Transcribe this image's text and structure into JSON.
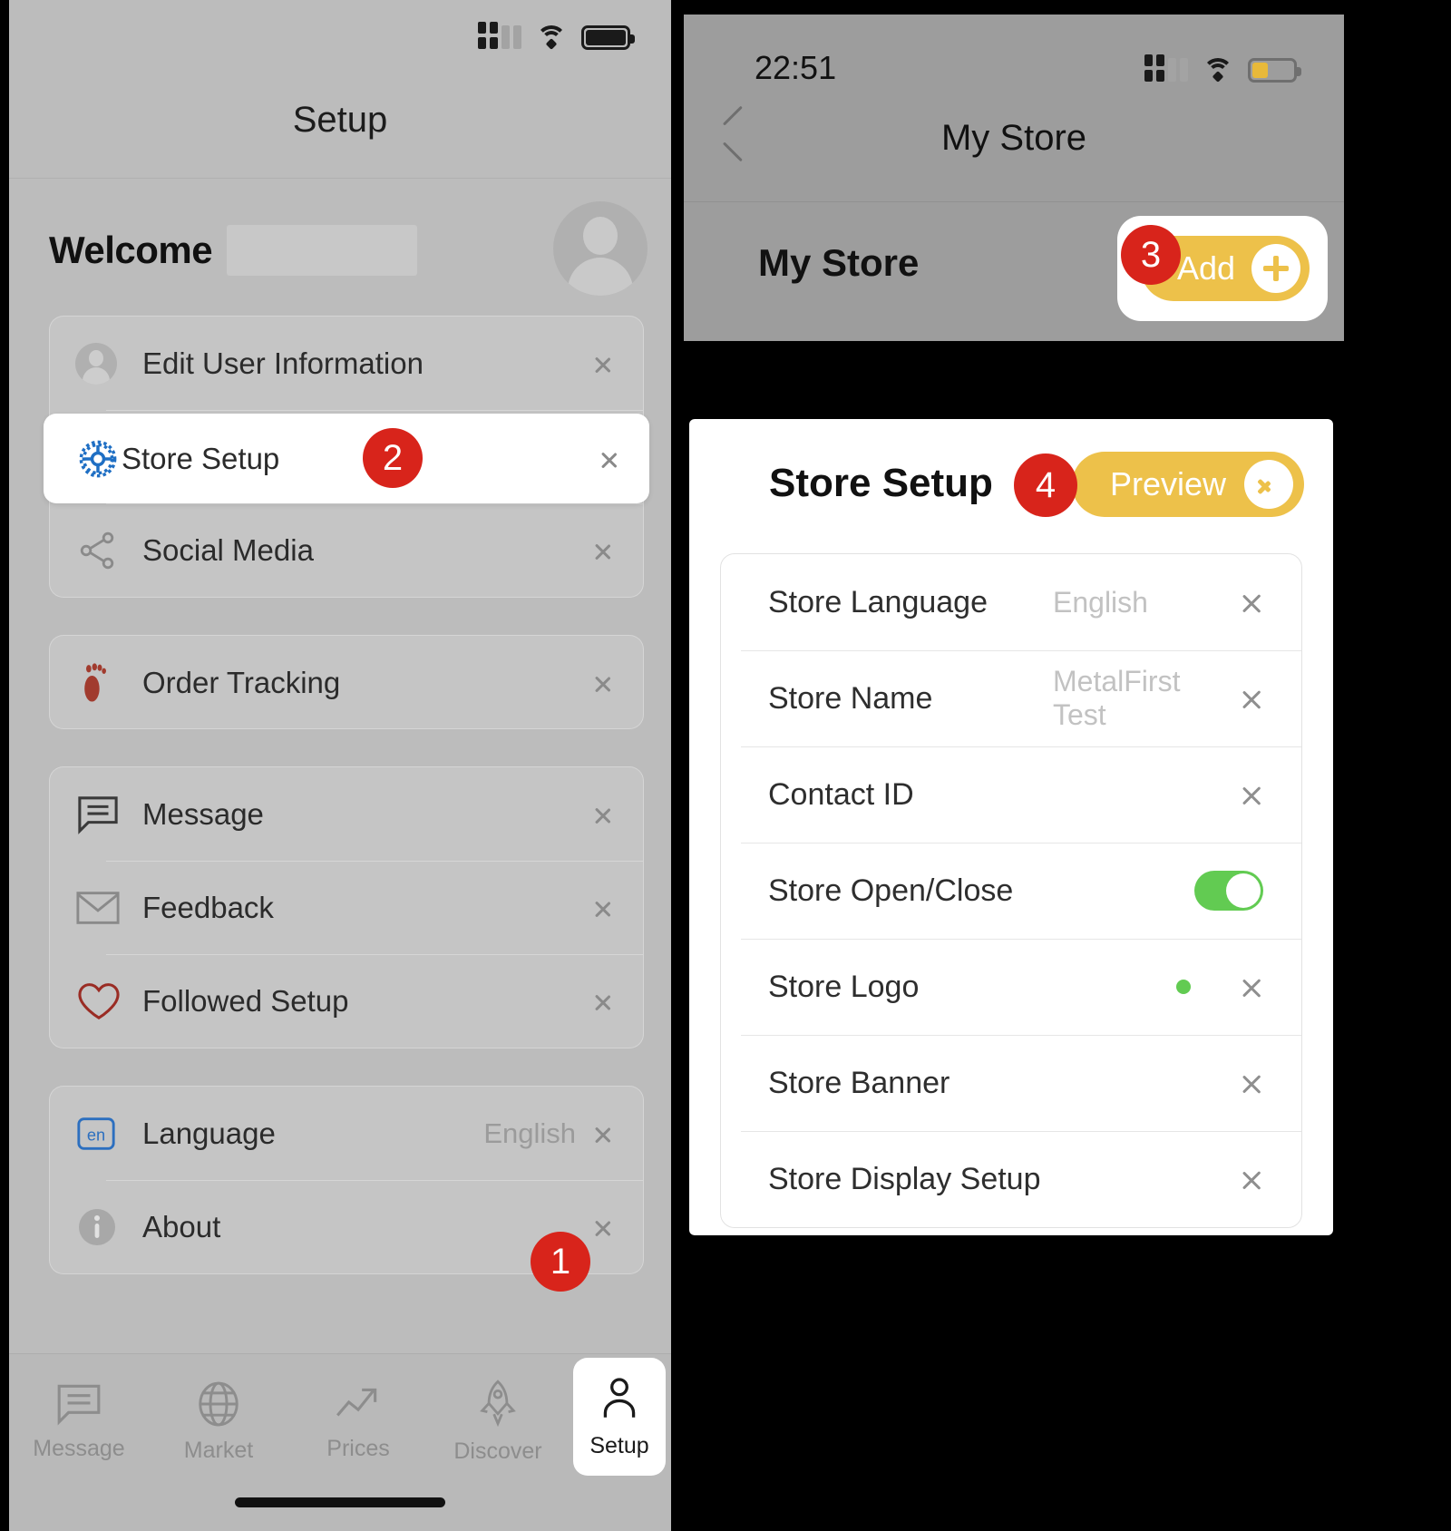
{
  "left_phone": {
    "status_bar": {
      "signal_icon": "cellular-signal-icon",
      "wifi_icon": "wifi-icon",
      "battery_icon": "battery-full-icon"
    },
    "nav_title": "Setup",
    "welcome": {
      "greeting": "Welcome",
      "avatar_icon": "user-avatar-icon"
    },
    "group1": [
      {
        "label": "Edit User Information",
        "icon": "user-avatar-icon"
      },
      {
        "label": "Store Setup",
        "icon": "gear-icon",
        "badge": "2",
        "highlighted": true
      },
      {
        "label": "Social Media",
        "icon": "share-icon"
      }
    ],
    "group2": [
      {
        "label": "Order Tracking",
        "icon": "footprint-icon"
      }
    ],
    "group3": [
      {
        "label": "Message",
        "icon": "chat-bubble-icon"
      },
      {
        "label": "Feedback",
        "icon": "envelope-icon"
      },
      {
        "label": "Followed Setup",
        "icon": "heart-icon"
      }
    ],
    "group4": [
      {
        "label": "Language",
        "icon": "en-language-icon",
        "value": "English"
      },
      {
        "label": "About",
        "icon": "info-icon"
      }
    ],
    "tabbar": [
      {
        "label": "Message",
        "icon": "chat-bubble-icon",
        "active": false
      },
      {
        "label": "Market",
        "icon": "globe-icon",
        "active": false
      },
      {
        "label": "Prices",
        "icon": "trending-up-icon",
        "active": false
      },
      {
        "label": "Discover",
        "icon": "rocket-icon",
        "active": false
      },
      {
        "label": "Setup",
        "icon": "person-icon",
        "active": true,
        "badge": "1"
      }
    ]
  },
  "my_store_panel": {
    "status_bar": {
      "time": "22:51",
      "signal_icon": "cellular-signal-icon",
      "wifi_icon": "wifi-icon",
      "battery_icon": "battery-low-icon"
    },
    "nav": {
      "back_icon": "chevron-left-icon",
      "title": "My Store"
    },
    "section_label": "My Store",
    "add_button": {
      "label": "Add",
      "icon": "plus-circle-icon",
      "badge": "3"
    }
  },
  "store_setup_panel": {
    "title": "Store Setup",
    "badge": "4",
    "preview_button": {
      "label": "Preview",
      "icon": "arrow-right-circle-icon"
    },
    "rows": [
      {
        "label": "Store Language",
        "value": "English",
        "accessory": "chevron"
      },
      {
        "label": "Store Name",
        "value": "MetalFirst Test",
        "accessory": "chevron"
      },
      {
        "label": "Contact ID",
        "value": "",
        "accessory": "chevron"
      },
      {
        "label": "Store Open/Close",
        "value": "",
        "accessory": "toggle-on"
      },
      {
        "label": "Store Logo",
        "value": "",
        "accessory": "dot-chevron"
      },
      {
        "label": "Store Banner",
        "value": "",
        "accessory": "chevron"
      },
      {
        "label": "Store Display Setup",
        "value": "",
        "accessory": "chevron"
      }
    ]
  },
  "colors": {
    "badge_red": "#d8241b",
    "accent_yellow": "#edc14a",
    "toggle_green": "#62cb52",
    "dimmed_bg": "#bcbcbc"
  }
}
